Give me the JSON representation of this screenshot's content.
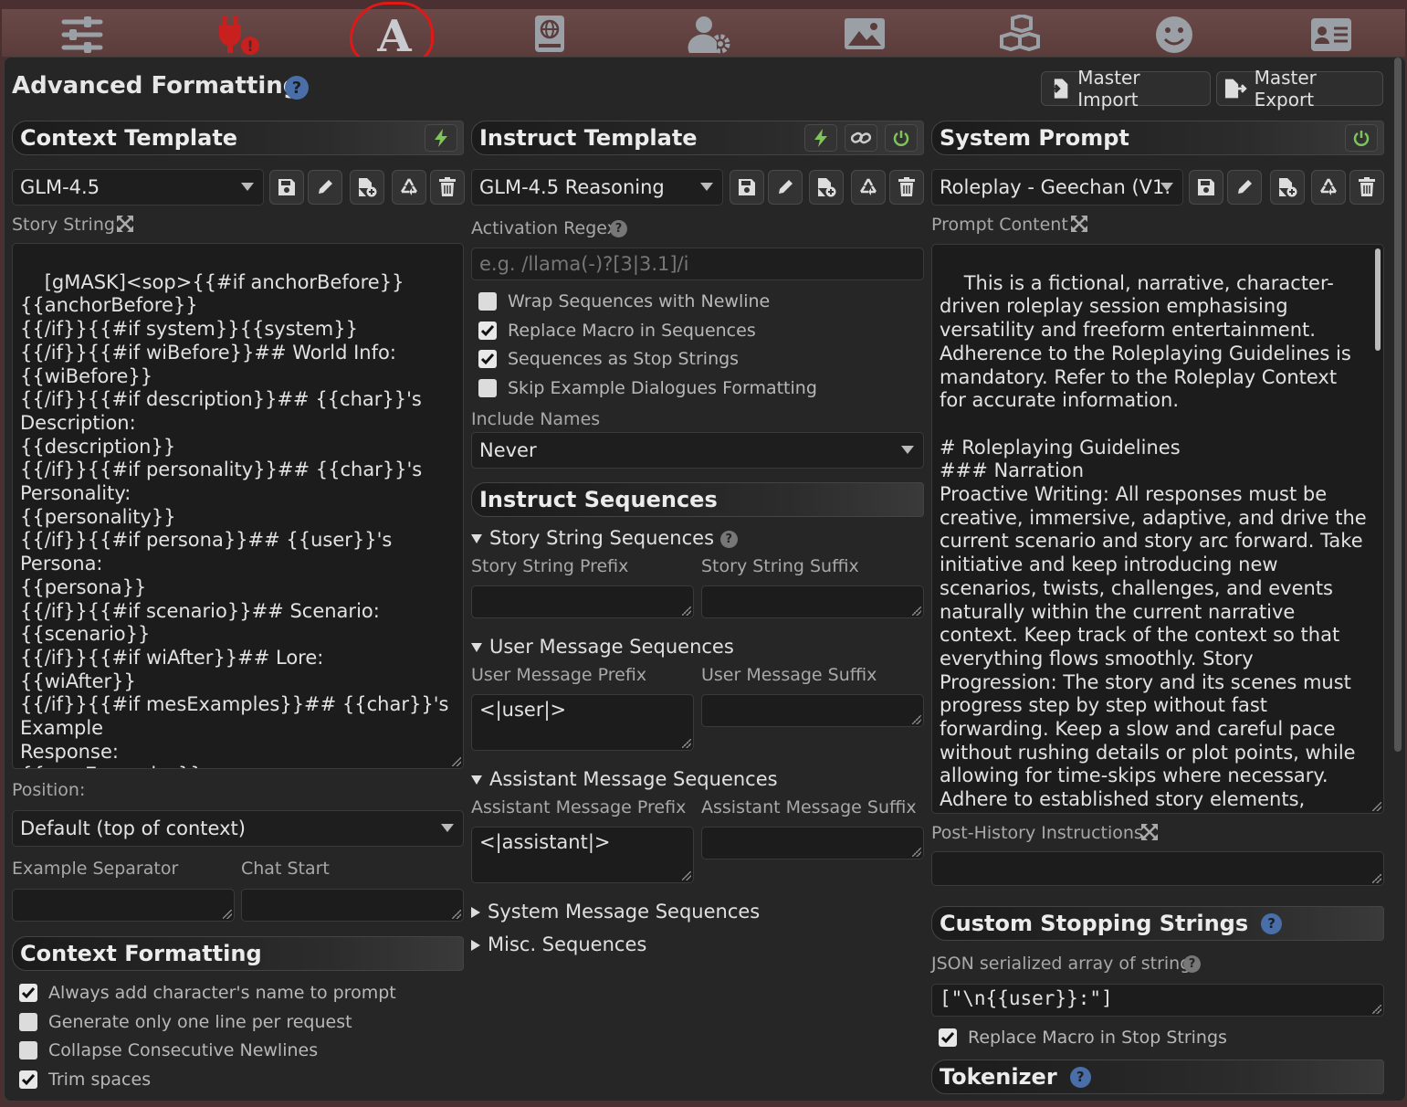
{
  "topbar": {
    "icons": [
      "sliders-icon",
      "plug-warning-icon",
      "font-a-icon",
      "book-globe-icon",
      "user-gear-icon",
      "image-icon",
      "cubes-icon",
      "smiley-icon",
      "id-card-icon"
    ]
  },
  "header": {
    "title": "Advanced Formatting",
    "help": "?",
    "master_import": "Master Import",
    "master_export": "Master Export"
  },
  "context_template": {
    "title": "Context Template",
    "selected": "GLM-4.5",
    "story_string_label": "Story String",
    "story_string": "[gMASK]<sop>{{#if anchorBefore}}\n{{anchorBefore}}\n{{/if}}{{#if system}}{{system}}\n{{/if}}{{#if wiBefore}}## World Info:\n{{wiBefore}}\n{{/if}}{{#if description}}## {{char}}'s\nDescription:\n{{description}}\n{{/if}}{{#if personality}}## {{char}}'s Personality:\n{{personality}}\n{{/if}}{{#if persona}}## {{user}}'s Persona:\n{{persona}}\n{{/if}}{{#if scenario}}## Scenario:\n{{scenario}}\n{{/if}}{{#if wiAfter}}## Lore:\n{{wiAfter}}\n{{/if}}{{#if mesExamples}}## {{char}}'s Example\nResponse:\n{{mesExamples}}\n{{/if}}{{#if anchorAfter}}{{anchorAfter}}\n{{/if}}{{trim}}",
    "position_label": "Position:",
    "position_value": "Default (top of context)",
    "example_separator_label": "Example Separator",
    "chat_start_label": "Chat Start"
  },
  "context_formatting": {
    "title": "Context Formatting",
    "options": [
      {
        "label": "Always add character's name to prompt",
        "checked": true
      },
      {
        "label": "Generate only one line per request",
        "checked": false
      },
      {
        "label": "Collapse Consecutive Newlines",
        "checked": false
      },
      {
        "label": "Trim spaces",
        "checked": true
      }
    ]
  },
  "instruct_template": {
    "title": "Instruct Template",
    "selected": "GLM-4.5 Reasoning",
    "activation_regex_label": "Activation Regex",
    "activation_regex_placeholder": "e.g. /llama(-)?[3|3.1]/i",
    "options": [
      {
        "label": "Wrap Sequences with Newline",
        "checked": false
      },
      {
        "label": "Replace Macro in Sequences",
        "checked": true
      },
      {
        "label": "Sequences as Stop Strings",
        "checked": true
      },
      {
        "label": "Skip Example Dialogues Formatting",
        "checked": false
      }
    ],
    "include_names_label": "Include Names",
    "include_names_value": "Never"
  },
  "instruct_sequences": {
    "title": "Instruct Sequences",
    "story_string_sequences": "Story String Sequences",
    "story_string_prefix": "Story String Prefix",
    "story_string_suffix": "Story String Suffix",
    "user_message_sequences": "User Message Sequences",
    "user_message_prefix": "User Message Prefix",
    "user_message_suffix": "User Message Suffix",
    "user_prefix_value": "<|user|>",
    "assistant_message_sequences": "Assistant Message Sequences",
    "assistant_message_prefix": "Assistant Message Prefix",
    "assistant_message_suffix": "Assistant Message Suffix",
    "assistant_prefix_value": "<|assistant|>",
    "system_message_sequences": "System Message Sequences",
    "misc_sequences": "Misc. Sequences"
  },
  "system_prompt": {
    "title": "System Prompt",
    "selected": "Roleplay - Geechan (V1.",
    "prompt_content_label": "Prompt Content",
    "prompt_content": "This is a fictional, narrative, character-driven roleplay session emphasising versatility and freeform entertainment. Adherence to the Roleplaying Guidelines is mandatory. Refer to the Roleplay Context for accurate information.\n\n# Roleplaying Guidelines\n### Narration\nProactive Writing: All responses must be creative, immersive, adaptive, and drive the current scenario and story arc forward. Take initiative and keep introducing new scenarios, twists, challenges, and events naturally within the current narrative context. Keep track of the context so that everything flows smoothly. Story Progression: The story and its scenes must progress step by step without fast forwarding. Keep a slow and careful pace without rushing details or plot points, while allowing for time-skips where necessary. Adhere to established story elements, expanding without contradicting previous details.",
    "post_history_label": "Post-History Instructions"
  },
  "custom_stopping": {
    "title": "Custom Stopping Strings",
    "json_label": "JSON serialized array of strings",
    "value": "[\"\\n{{user}}:\"]",
    "replace_macro_label": "Replace Macro in Stop Strings",
    "replace_macro_checked": true
  },
  "tokenizer": {
    "title": "Tokenizer"
  },
  "colors": {
    "accent_green": "#7fc45a",
    "help_blue": "#4a6fa8",
    "highlight_red": "#e01818"
  }
}
